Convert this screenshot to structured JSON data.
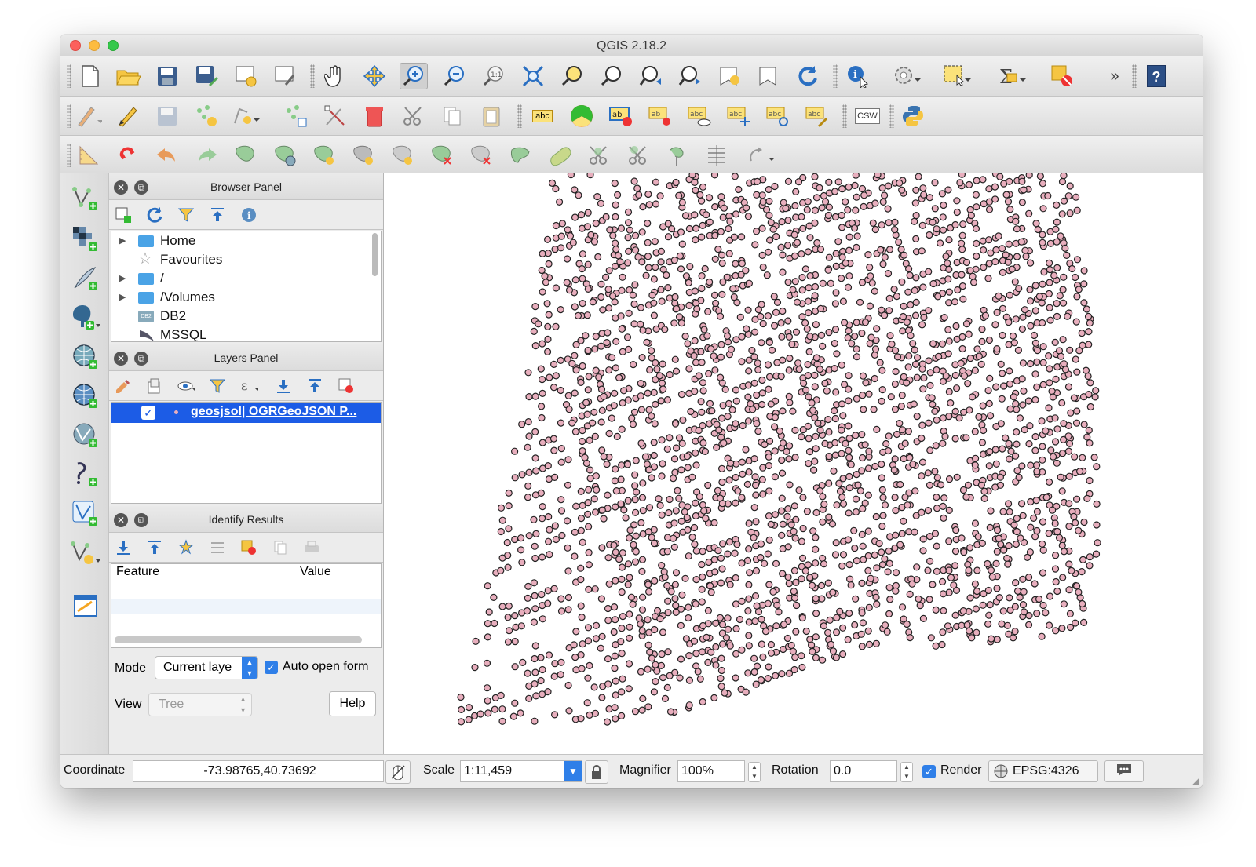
{
  "window": {
    "title": "QGIS 2.18.2"
  },
  "toolbar1": {
    "items": [
      "new-project",
      "open-project",
      "save-project",
      "save-as",
      "new-print-composer",
      "composer-manager",
      "pan",
      "pan-to-selection",
      "zoom-in",
      "zoom-out",
      "zoom-native",
      "zoom-full",
      "zoom-to-selection",
      "zoom-to-layer",
      "zoom-last",
      "zoom-next",
      "new-bookmark",
      "show-bookmarks",
      "refresh",
      "identify",
      "actions",
      "select",
      "statistics",
      "deselect"
    ],
    "overflow": "»",
    "help": "?"
  },
  "toolbar2": {
    "abc": "abc",
    "csw": "CSW"
  },
  "browser": {
    "title": "Browser Panel",
    "items": [
      {
        "label": "Home",
        "expand": "▶"
      },
      {
        "label": "Favourites",
        "expand": ""
      },
      {
        "label": "/",
        "expand": "▶"
      },
      {
        "label": "/Volumes",
        "expand": "▶"
      },
      {
        "label": "DB2",
        "expand": ""
      },
      {
        "label": "MSSQL",
        "expand": ""
      }
    ]
  },
  "layers": {
    "title": "Layers Panel",
    "items": [
      {
        "label": "geosjsol| OGRGeoJSON P...",
        "checked": true
      }
    ]
  },
  "identify": {
    "title": "Identify Results",
    "columns": [
      "Feature",
      "Value"
    ],
    "mode_label": "Mode",
    "mode_value": "Current laye",
    "auto_open_label": "Auto open form",
    "view_label": "View",
    "view_value": "Tree",
    "help_label": "Help"
  },
  "status": {
    "coordinate_label": "Coordinate",
    "coordinate_value": "-73.98765,40.73692",
    "scale_label": "Scale",
    "scale_value": "1:11,459",
    "magnifier_label": "Magnifier",
    "magnifier_value": "100%",
    "rotation_label": "Rotation",
    "rotation_value": "0.0",
    "render_label": "Render",
    "crs_value": "EPSG:4326"
  },
  "colors": {
    "point_fill": "#e8aebd",
    "point_stroke": "#222222",
    "selection": "#1c5ce6",
    "accent": "#2f7fe8"
  }
}
